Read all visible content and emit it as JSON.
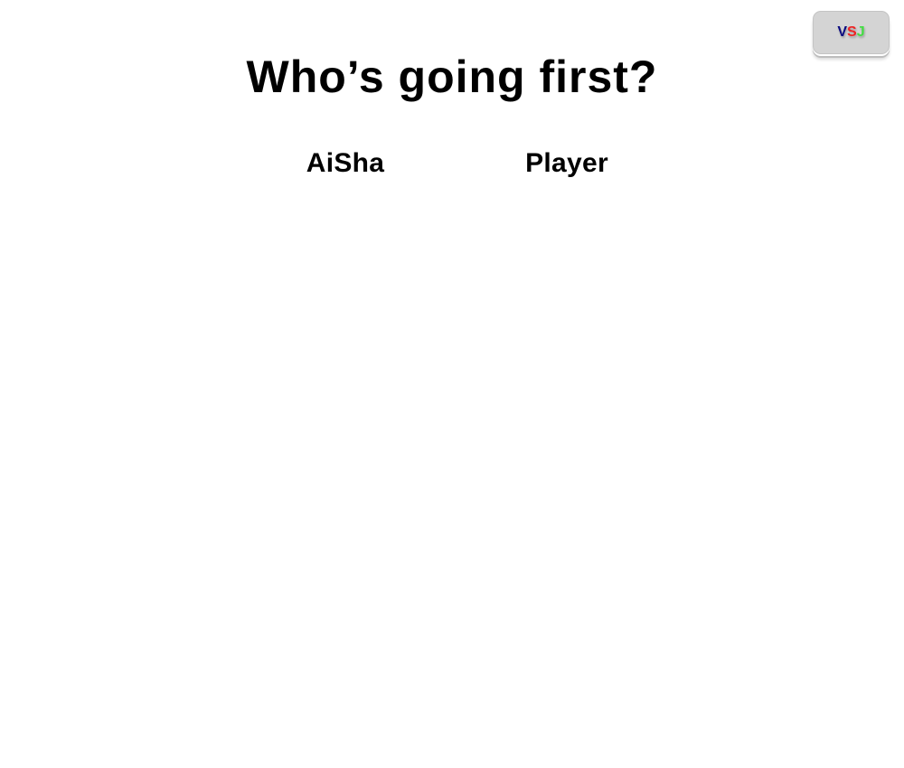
{
  "title": "Who’s going first?",
  "choices": [
    {
      "label": "AiSha"
    },
    {
      "label": "Player"
    }
  ],
  "badge": {
    "letters": [
      "V",
      "S",
      "J"
    ],
    "colors": [
      "#0a0a80",
      "#ee2222",
      "#44dd44"
    ]
  }
}
